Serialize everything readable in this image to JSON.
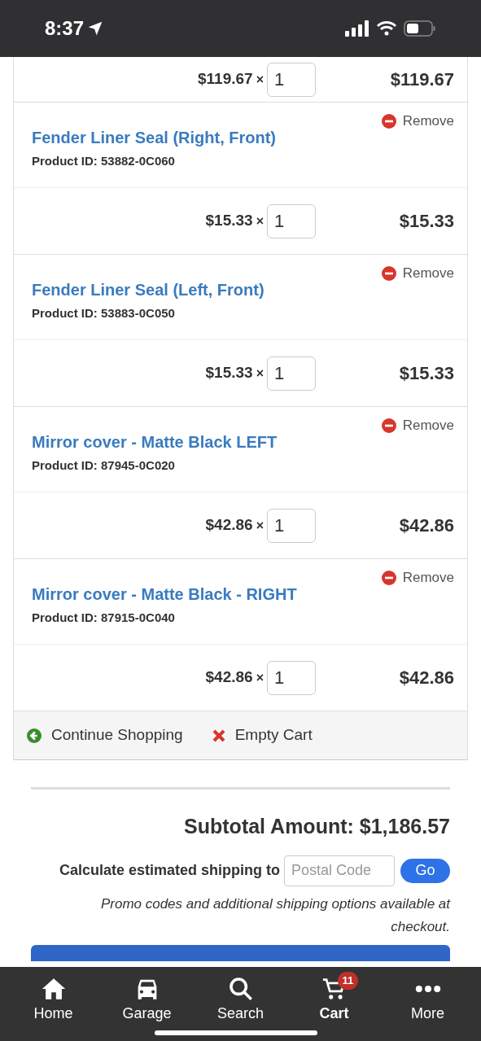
{
  "status_bar": {
    "time": "8:37"
  },
  "partial_item": {
    "unit_price": "$119.67",
    "times": "×",
    "quantity": "1",
    "total": "$119.67"
  },
  "items": [
    {
      "title": "Fender Liner Seal (Right, Front)",
      "product_id": "Product ID: 53882-0C060",
      "remove": "Remove",
      "unit_price": "$15.33",
      "times": "×",
      "quantity": "1",
      "total": "$15.33"
    },
    {
      "title": "Fender Liner Seal (Left, Front)",
      "product_id": "Product ID: 53883-0C050",
      "remove": "Remove",
      "unit_price": "$15.33",
      "times": "×",
      "quantity": "1",
      "total": "$15.33"
    },
    {
      "title": "Mirror cover - Matte Black LEFT",
      "product_id": "Product ID: 87945-0C020",
      "remove": "Remove",
      "unit_price": "$42.86",
      "times": "×",
      "quantity": "1",
      "total": "$42.86"
    },
    {
      "title": "Mirror cover - Matte Black - RIGHT",
      "product_id": "Product ID: 87915-0C040",
      "remove": "Remove",
      "unit_price": "$42.86",
      "times": "×",
      "quantity": "1",
      "total": "$42.86"
    }
  ],
  "cart_actions": {
    "continue": "Continue Shopping",
    "empty": "Empty Cart"
  },
  "subtotal": "Subtotal Amount: $1,186.57",
  "shipping": {
    "label": "Calculate estimated shipping to",
    "placeholder": "Postal Code",
    "button": "Go"
  },
  "promo_note": "Promo codes and additional shipping options available at checkout.",
  "tab_bar": [
    {
      "kind": "home",
      "label": "Home",
      "selected": false
    },
    {
      "kind": "garage",
      "label": "Garage",
      "selected": false
    },
    {
      "kind": "search",
      "label": "Search",
      "selected": false
    },
    {
      "kind": "cart",
      "label": "Cart",
      "selected": true,
      "badge": "11"
    },
    {
      "kind": "more",
      "label": "More",
      "selected": false
    }
  ]
}
